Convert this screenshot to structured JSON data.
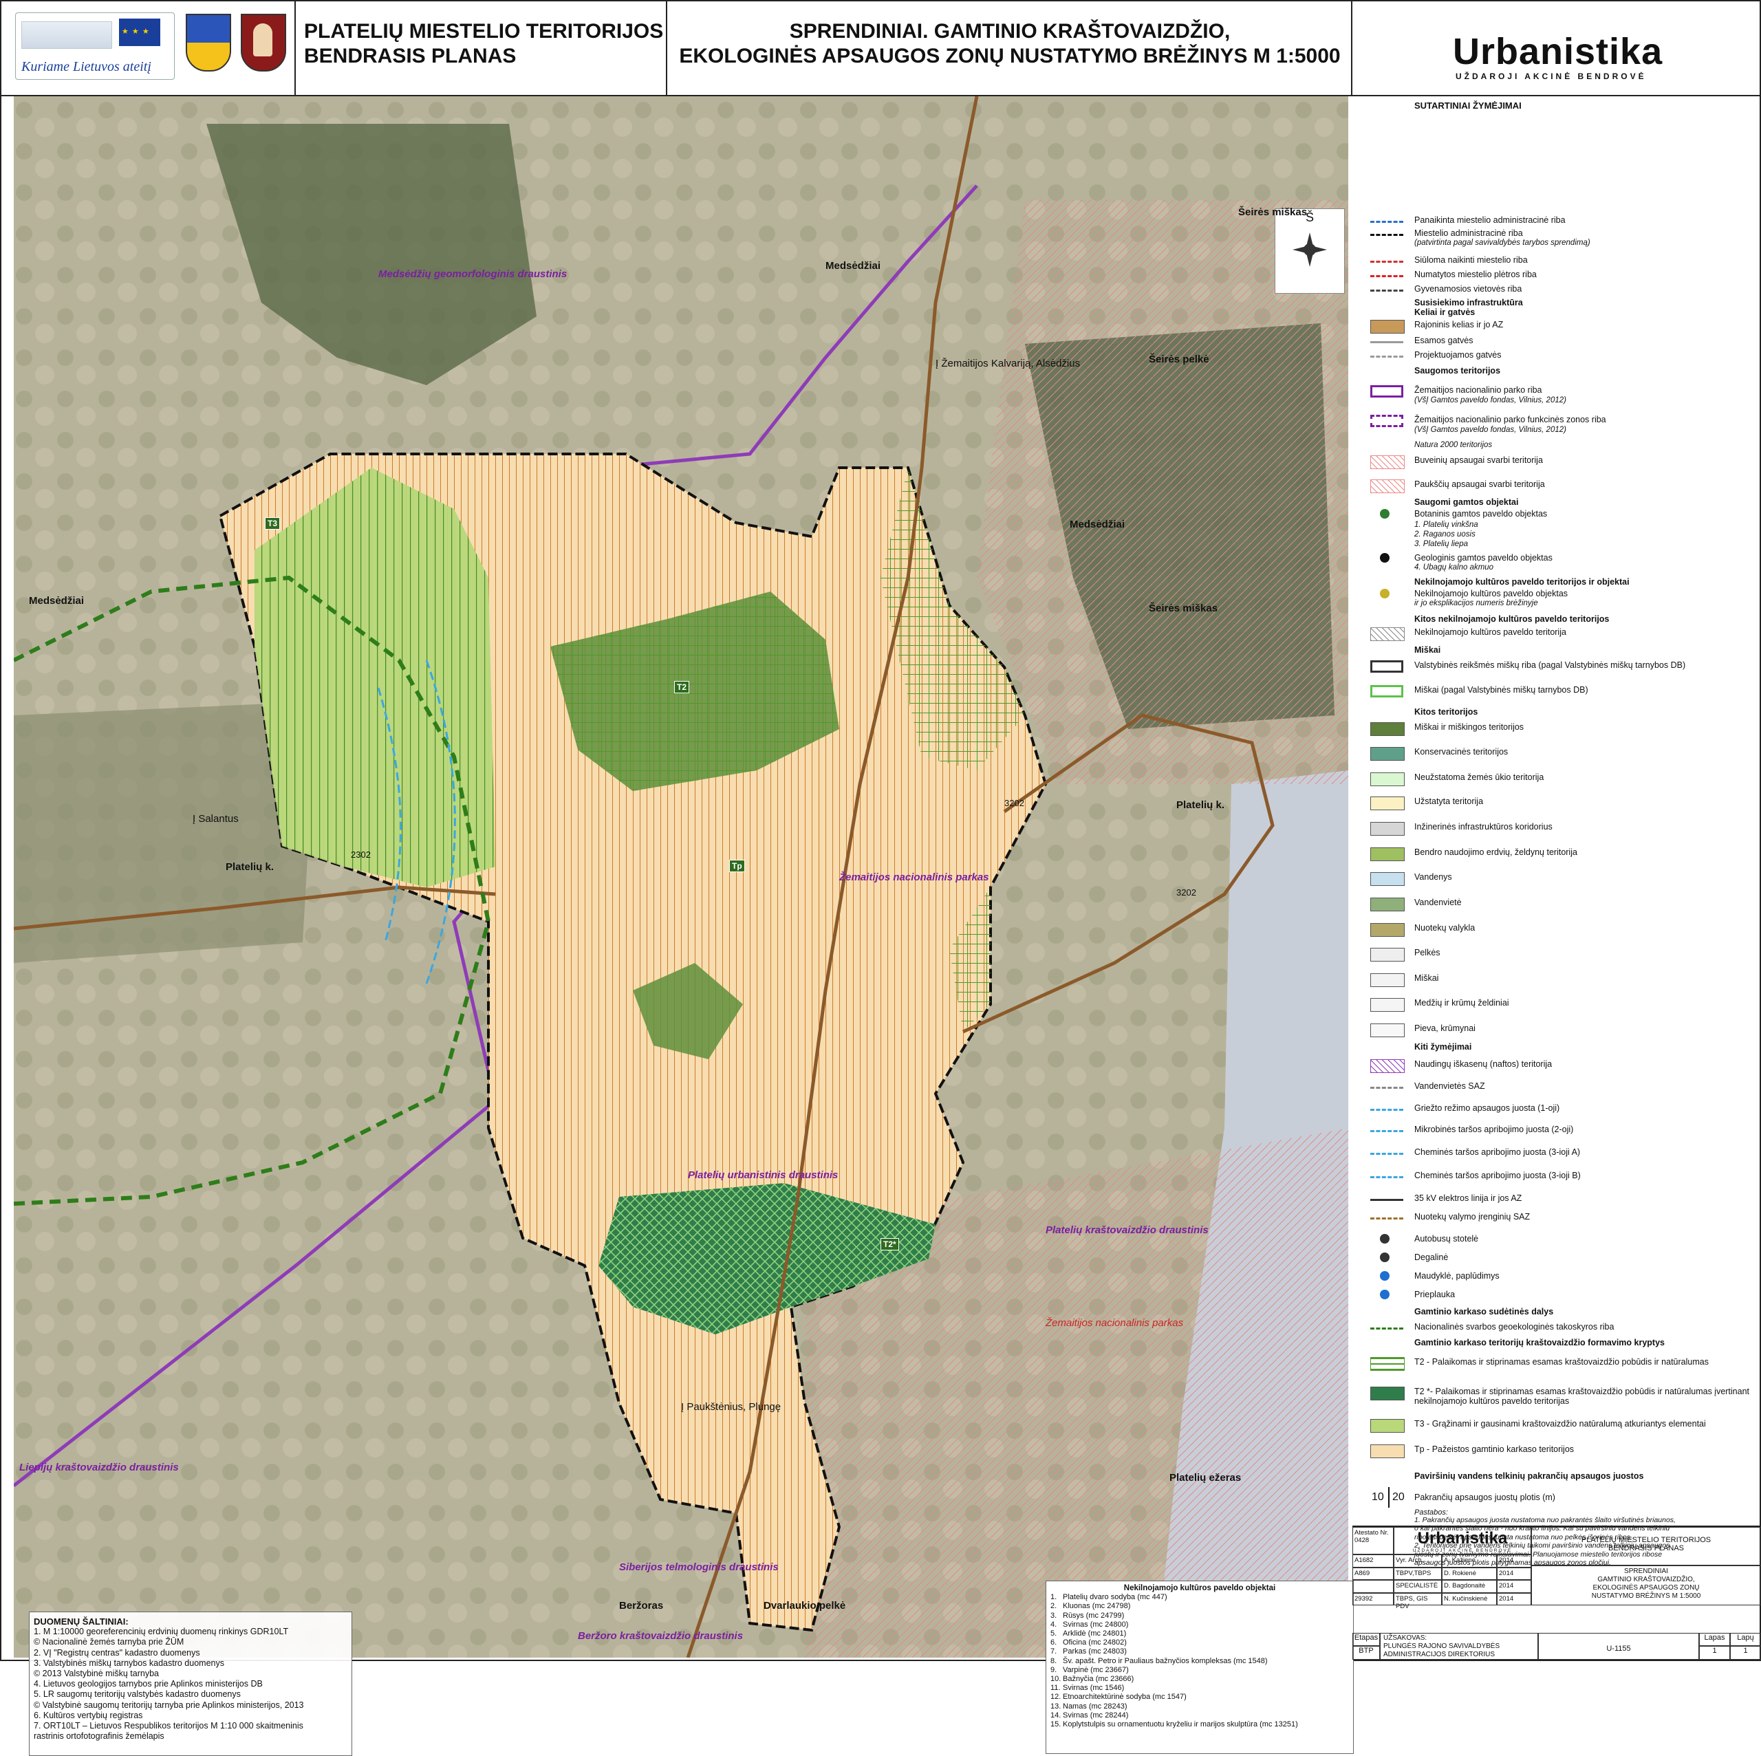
{
  "header": {
    "eu_slogan": "Kuriame Lietuvos ateitį",
    "title_left": [
      "PLATELIŲ MIESTELIO TERITORIJOS",
      "BENDRASIS PLANAS"
    ],
    "title_center": [
      "SPRENDINIAI. GAMTINIO KRAŠTOVAIZDŽIO,",
      "EKOLOGINĖS APSAUGOS ZONŲ NUSTATYMO BRĖŽINYS  M 1:5000"
    ],
    "brand": "Urbanistika",
    "brand_sub": "UŽDAROJI AKCINĖ BENDROVĖ"
  },
  "map": {
    "compass_label": "Š",
    "place_names": {
      "medsedziai_top": "Medsėdžiai",
      "medsedziai_mid": "Medsėdžiai",
      "medsedziai_left": "Medsėdžiai",
      "seires_miskas_top": "Šeirės miškas",
      "seires_miskas_mid": "Šeirės miškas",
      "seires_pelke": "Šeirės pelkė",
      "plateliu_k_left": "Platelių k.",
      "plateliu_k_right": "Platelių k.",
      "plateliu_ezeras": "Platelių ežeras",
      "berzoras": "Beržoras",
      "dvarlaukio_pelke": "Dvarlaukio pelkė"
    },
    "reserves": {
      "medsedziu": "Medsėdžių geomorfologinis draustinis",
      "zemaitijos_np": "Žemaitijos nacionalinis parkas",
      "plateliu_urbanistinis": "Platelių urbanistinis draustinis",
      "plateliu_krastovaizdzio": "Platelių kraštovaizdžio draustinis",
      "liepiju": "Liepijų kraštovaizdžio draustinis",
      "siberijos": "Siberijos telmologinis draustinis",
      "berzoro": "Beržoro kraštovaizdžio draustinis",
      "zemaitijos_np_red": "Žemaitijos nacionalinis parkas"
    },
    "road_directions": {
      "kalvarija": "Į Žemaitijos Kalvariją, Alsėdžius",
      "salantus": "Į Salantus",
      "plunge": "Į Paukštėnius, Plungę"
    },
    "road_numbers": [
      "2302",
      "3202",
      "3202"
    ],
    "zone_labels": [
      "T2",
      "T3",
      "Tp",
      "T2*"
    ]
  },
  "sources": {
    "heading": "DUOMENŲ ŠALTINIAI:",
    "lines": [
      "1. M 1:10000 georeferencinių erdvinių duomenų rinkinys GDR10LT",
      "    © Nacionalinė žemės tarnyba prie ŽŪM",
      "2. VĮ \"Registrų centras\" kadastro duomenys",
      "3. Valstybinės miškų tarnybos kadastro duomenys",
      "© 2013 Valstybinė miškų tarnyba",
      "4. Lietuvos geologijos tarnybos prie Aplinkos ministerijos DB",
      "5. LR saugomų teritorijų valstybės kadastro duomenys",
      "© Valstybinė saugomų teritorijų tarnyba prie Aplinkos ministerijos, 2013",
      "6. Kultūros vertybių registras",
      "7. ORT10LT – Lietuvos Respublikos teritorijos M 1:10 000 skaitmeninis",
      "rastrinis ortofotografinis žemėlapis"
    ]
  },
  "heritage": {
    "heading": "Nekilnojamojo kultūros paveldo objektai",
    "items": [
      "Platelių dvaro sodyba (mc 447)",
      "Kluonas (mc 24798)",
      "Rūsys (mc 24799)",
      "Svirnas (mc 24800)",
      "Arklidė (mc 24801)",
      "Oficina (mc 24802)",
      "Parkas (mc 24803)",
      "Šv. apašt. Petro ir Pauliaus bažnyčios kompleksas (mc 1548)",
      "Varpinė (mc 23667)",
      "Bažnyčia (mc 23666)",
      "Svirnas (mc 1546)",
      "Etnoarchitektūrinė sodyba (mc 1547)",
      "Namas (mc 28243)",
      "Svirnas (mc 28244)",
      "Koplytstulpis su ornamentuotu kryželiu ir marijos skulptūra (mc 13251)"
    ]
  },
  "legend": {
    "heading": "SUTARTINIAI ŽYMĖJIMAI",
    "sections": {
      "infra": "Susisiekimo infrastruktūra",
      "roads": "Keliai ir gatvės",
      "protected": "Saugomos teritorijos",
      "natural_objects": "Saugomi gamtos objektai",
      "heritage": "Nekilnojamojo kultūros paveldo teritorijos ir objektai",
      "other_heritage": "Kitos nekilnojamojo kultūros paveldo teritorijos",
      "forests": "Miškai",
      "other_territories": "Kitos teritorijos",
      "other_marks": "Kiti žymėjimai",
      "framework_parts": "Gamtinio karkaso sudėtinės dalys",
      "framework_directions": "Gamtinio karkaso teritorijų kraštovaizdžio formavimo kryptys",
      "buffer": "Paviršinių vandens telkinių pakrančių apsaugos juostos"
    },
    "items": {
      "cancelled_boundary": "Panaikinta miestelio administracinė riba",
      "admin_boundary": "Miestelio administracinė riba",
      "admin_boundary_note": "(patvirtinta pagal savivaldybės tarybos sprendimą)",
      "proposed_cancel": "Siūloma naikinti miestelio riba",
      "expansion": "Numatytos miestelio plėtros  riba",
      "settlement": "Gyvenamosios vietovės riba",
      "district_road": "Rajoninis kelias ir jo AZ",
      "road_code": "2302",
      "existing_streets": "Esamos gatvės",
      "planned_streets": "Projektuojamos gatvės",
      "np_boundary": "Žemaitijos nacionalinio parko riba",
      "np_boundary_src": "(VšĮ Gamtos paveldo fondas, Vilnius, 2012)",
      "np_zone_boundary": "Žemaitijos nacionalinio parko funkcinės zonos riba",
      "np_zone_src": "(VšĮ Gamtos paveldo fondas, Vilnius, 2012)",
      "natura": "Natura 2000 teritorijos",
      "habitat": "Buveinių apsaugai svarbi teritorija",
      "birds": "Paukščių apsaugai svarbi teritorija",
      "botanical": "Botaninis gamtos paveldo objektas",
      "bot1": "1. Platelių vinkšna",
      "bot2": "2. Raganos uosis",
      "bot3": "3. Platelių liepa",
      "geological": "Geologinis gamtos paveldo objektas",
      "geo4": "4. Ubagų kalno akmuo",
      "heritage_obj": "Nekilnojamojo kultūros paveldo objektas",
      "heritage_obj2": "ir jo eksplikacijos numeris  brėžinyje",
      "heritage_terr": "Nekilnojamojo kultūros paveldo teritorija",
      "state_forest": "Valstybinės reikšmės miškų riba (pagal Valstybinės miškų tarnybos DB)",
      "forests_db": "Miškai (pagal Valstybinės miškų tarnybos DB)",
      "forest_land": "Miškai ir miškingos teritorijos",
      "conservation": "Konservacinės teritorijos",
      "agri": "Neužstatoma žemės ūkio teritorija",
      "built": "Užstatyta teritorija",
      "engineering": "Inžinerinės infrastruktūros koridorius",
      "green": "Bendro naudojimo erdvių, želdynų teritorija",
      "water": "Vandenys",
      "wellfield": "Vandenvietė",
      "sewage": "Nuotekų valykla",
      "bogs": "Pelkės",
      "forests_small": "Miškai",
      "trees": "Medžių ir krūmų želdiniai",
      "meadow": "Pieva, krūmynai",
      "oil": "Naudingų iškasenų (naftos) teritorija",
      "wellfield_saz": "Vandenvietės SAZ",
      "strict": "Griežto režimo apsaugos juosta (1-oji)",
      "micro": "Mikrobinės taršos apribojimo juosta (2-oji)",
      "chemA": "Cheminės taršos apribojimo juosta (3-ioji A)",
      "chemB": "Cheminės taršos apribojimo juosta (3-ioji B)",
      "power": "35 kV elektros linija ir jos AZ",
      "sewage_saz": "Nuotekų valymo įrenginių SAZ",
      "bus": "Autobusų stotelė",
      "fuel": "Degalinė",
      "beach": "Maudyklė, paplūdimys",
      "pier": "Prieplauka",
      "geoeco": "Nacionalinės svarbos geoekologinės takoskyros riba",
      "t2": "T2 - Palaikomas ir stiprinamas esamas kraštovaizdžio pobūdis ir natūralumas",
      "t2s": "T2 *- Palaikomas ir stiprinamas esamas kraštovaizdžio pobūdis ir natūralumas įvertinant nekilnojamojo kultūros paveldo teritorijas",
      "t3": "T3 - Grąžinami ir gausinami kraštovaizdžio natūralumą atkuriantys elementai",
      "tp": "Tp - Pažeistos gamtinio karkaso teritorijos",
      "buffer_width": "Pakrančių apsaugos juostų plotis (m)",
      "buf_a": "10",
      "buf_b": "20"
    },
    "notes_heading": "Pastabos:",
    "notes": [
      "1. Pakrančių apsaugos juosta nustatoma nuo pakrantės šlaito viršutinės briaunos,",
      "o kai pakrantės šlaito nėra - nuo kranto linijos. Kai su paviršiniu vandens telkiniu",
      "ribojasi pelkė, apsaugos juosta nustatoma nuo pelkės išorinės ribos.",
      "2. Teritorijose prie vandens telkinių taikomi paviršinio vandens telkinių apsaugos",
      "juostų ir zonų tvarkymo reikalavimai. Planuojamose miestelio teritorijos ribose",
      "apsaugos juostos plotis prilyginamas apsaugos zonos pločiui."
    ]
  },
  "titleblock": {
    "atestato": "Atestato Nr. 0428",
    "brand": "Urbanistika",
    "brand_sub": "UŽDAROJI AKCINĖ BENDROVĖ",
    "project": [
      "PLATELIŲ MIESTELIO TERITORIJOS",
      "BENDRASIS PLANAS"
    ],
    "rows": [
      [
        "A1682",
        "Vyr. Arch.",
        "A. Kažiene",
        "2014"
      ],
      [
        "A869",
        "TBPV,TBPS",
        "D. Rokienė",
        "2014"
      ],
      [
        "",
        "SPECIALISTĖ",
        "D. Bagdonaitė",
        "2014"
      ],
      [
        "29392",
        "TBPS, GIS PDV",
        "N. Kučinskienė",
        "2014"
      ]
    ],
    "drawing": [
      "SPRENDINIAI",
      "GAMTINIO KRAŠTOVAIZDŽIO,",
      "EKOLOGINĖS APSAUGOS ZONŲ",
      "NUSTATYMO BRĖŽINYS  M 1:5000"
    ],
    "etapas_label": "Etapas",
    "etapas": "BTP",
    "client_label": "UŽSAKOVAS:",
    "client": [
      "PLUNGĖS RAJONO SAVIVALDYBĖS",
      "ADMINISTRACIJOS DIREKTORIUS"
    ],
    "code": "U-1155",
    "lapas_label": "Lapas",
    "lapas": "1",
    "lapu_label": "Lapų",
    "lapu": "1"
  }
}
